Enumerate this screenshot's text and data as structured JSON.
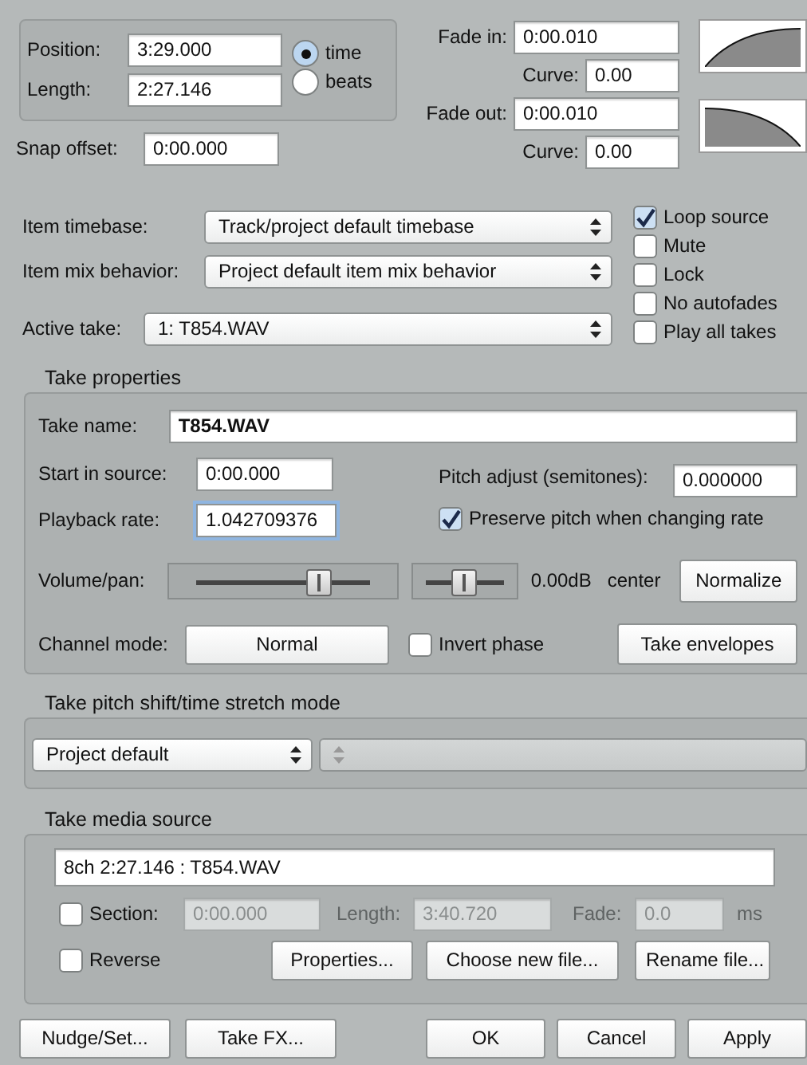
{
  "position_group": {
    "fields": [
      {
        "label": "Position:",
        "value": "3:29.000"
      },
      {
        "label": "Length:",
        "value": "2:27.146"
      }
    ],
    "radios": [
      {
        "label": "time",
        "selected": true
      },
      {
        "label": "beats",
        "selected": false
      }
    ]
  },
  "fades": [
    {
      "kind": "in",
      "label": "Fade in:",
      "value": "0:00.010",
      "curve_label": "Curve:",
      "curve": "0.00"
    },
    {
      "kind": "out",
      "label": "Fade out:",
      "value": "0:00.010",
      "curve_label": "Curve:",
      "curve": "0.00"
    }
  ],
  "snap_offset": {
    "label": "Snap offset:",
    "value": "0:00.000"
  },
  "dropdowns": [
    {
      "label": "Item timebase:",
      "value": "Track/project default timebase"
    },
    {
      "label": "Item mix behavior:",
      "value": "Project default item mix behavior"
    },
    {
      "label": "Active take:",
      "value": "1: T854.WAV"
    }
  ],
  "options": [
    {
      "label": "Loop source",
      "checked": true
    },
    {
      "label": "Mute",
      "checked": false
    },
    {
      "label": "Lock",
      "checked": false
    },
    {
      "label": "No autofades",
      "checked": false
    },
    {
      "label": "Play all takes",
      "checked": false
    }
  ],
  "take_properties": {
    "title": "Take properties",
    "take_name": {
      "label": "Take name:",
      "value": "T854.WAV"
    },
    "start_in_source": {
      "label": "Start in source:",
      "value": "0:00.000"
    },
    "pitch_adjust": {
      "label": "Pitch adjust (semitones):",
      "value": "0.000000"
    },
    "playback_rate": {
      "label": "Playback rate:",
      "value": "1.042709376"
    },
    "preserve_pitch": {
      "label": "Preserve pitch when changing rate",
      "checked": true
    },
    "volume_pan": {
      "label": "Volume/pan:",
      "volume": {
        "level": 0.66,
        "reading": "0.00dB"
      },
      "pan": {
        "level": 0.5,
        "reading": "center"
      }
    },
    "normalize_button": "Normalize",
    "channel_mode": {
      "label": "Channel mode:",
      "value": "Normal"
    },
    "invert_phase": {
      "label": "Invert phase",
      "checked": false
    },
    "envelopes_button": "Take envelopes"
  },
  "pitch_mode": {
    "title": "Take pitch shift/time stretch mode",
    "mode": "Project default"
  },
  "media_source": {
    "title": "Take media source",
    "source": "8ch 2:27.146 : T854.WAV",
    "section": {
      "label": "Section:",
      "checked": false,
      "start": "0:00.000",
      "length_label": "Length:",
      "length": "3:40.720",
      "fade_label": "Fade:",
      "fade": "0.0",
      "unit": "ms"
    },
    "reverse": {
      "label": "Reverse",
      "checked": false
    },
    "buttons": [
      "Properties...",
      "Choose new file...",
      "Rename file..."
    ]
  },
  "footer": {
    "left_buttons": [
      "Nudge/Set...",
      "Take FX..."
    ],
    "right_buttons": [
      "OK",
      "Cancel",
      "Apply"
    ]
  }
}
